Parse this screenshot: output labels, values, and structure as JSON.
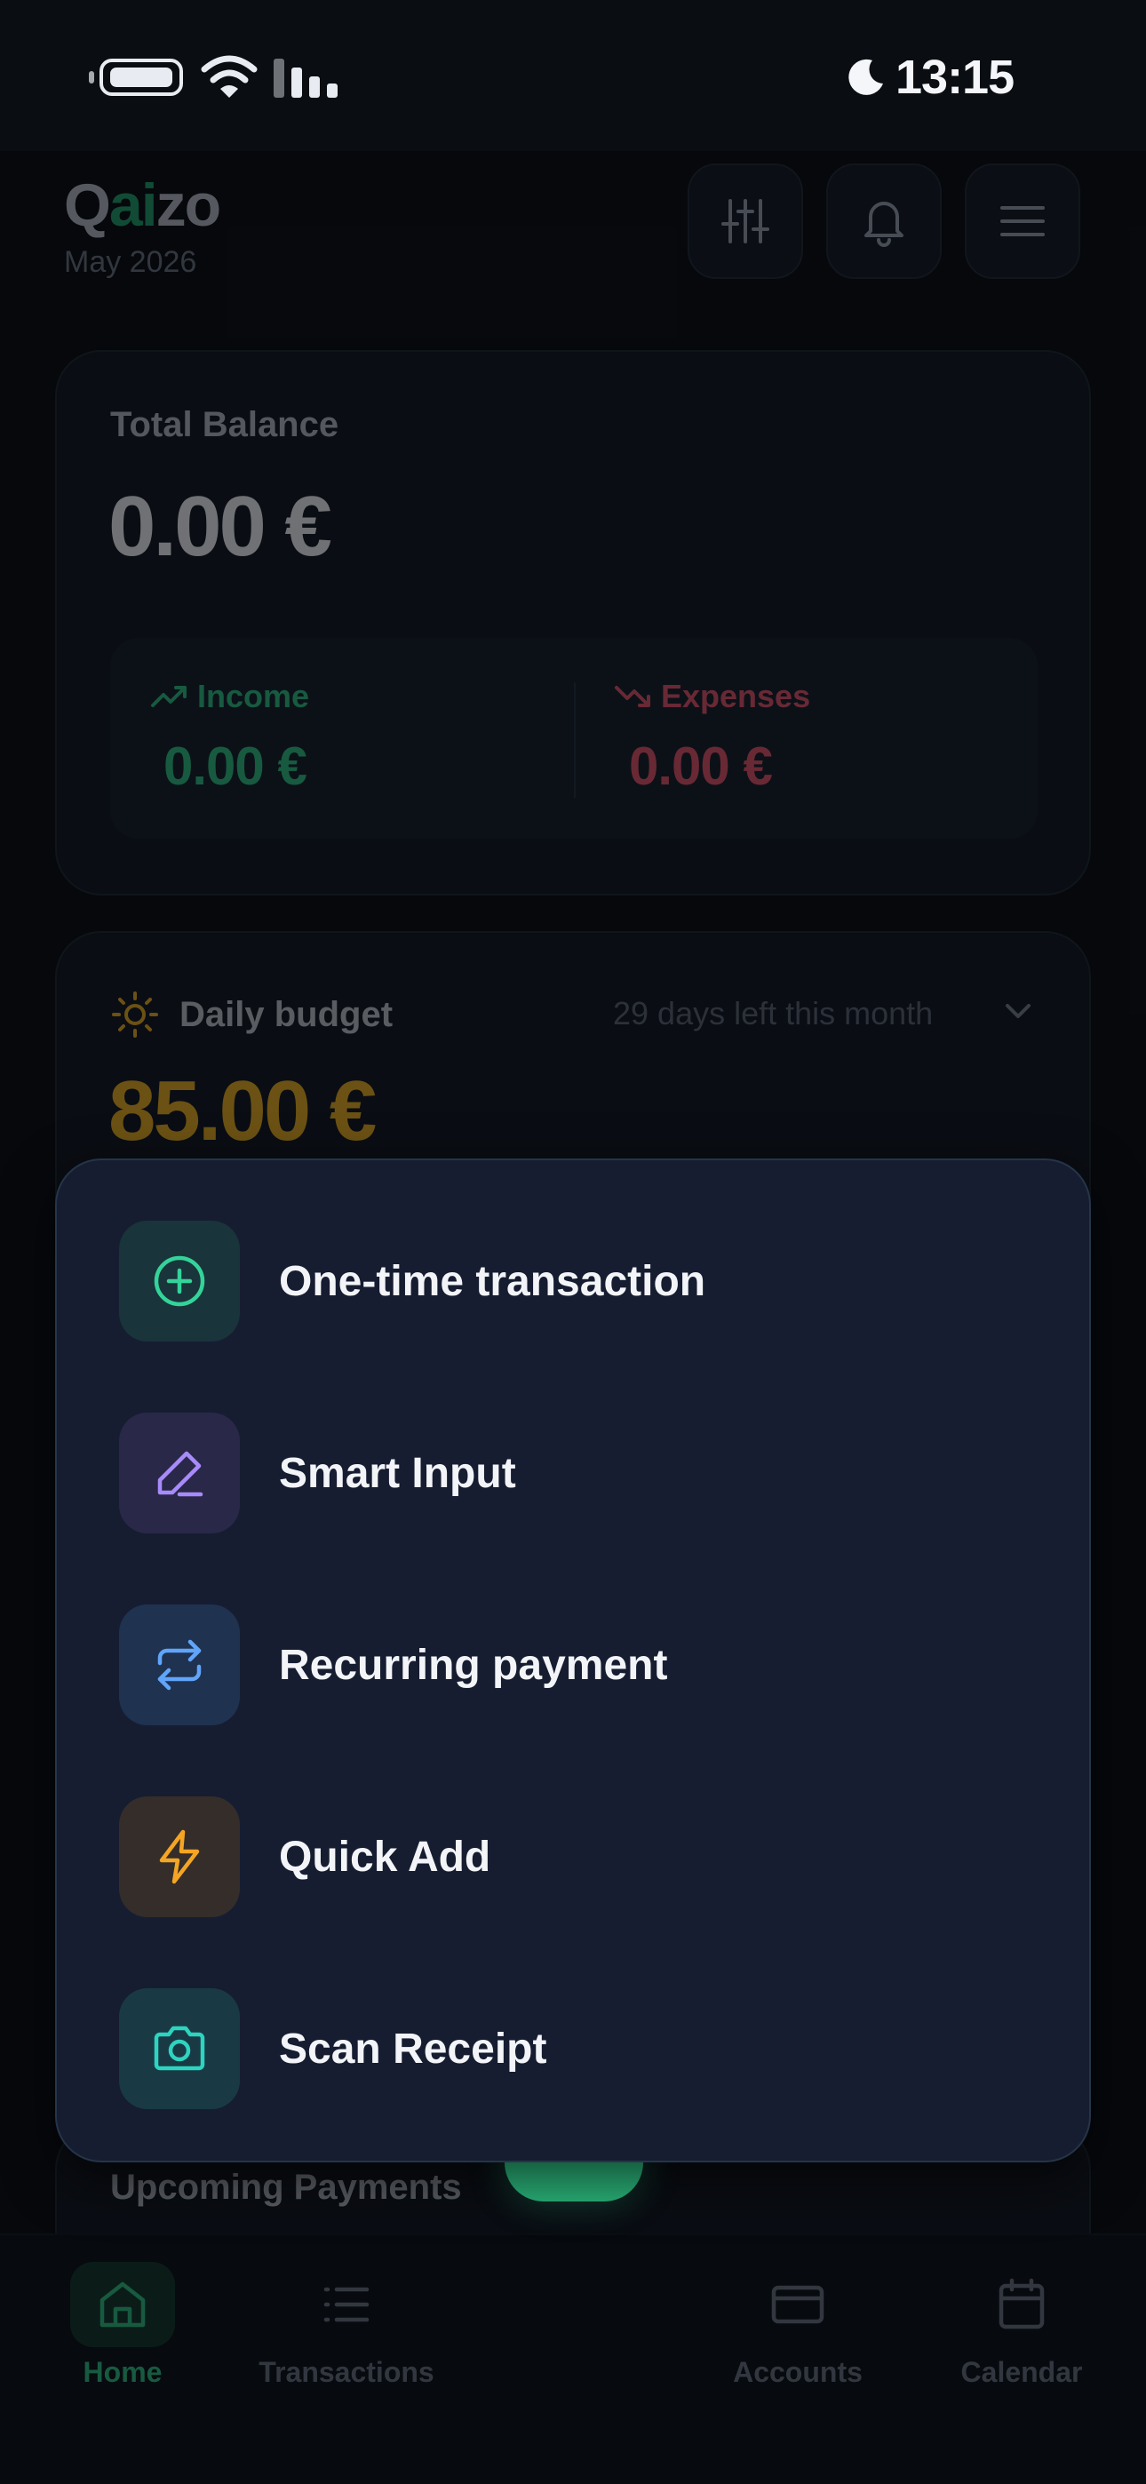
{
  "status_bar": {
    "time": "13:15"
  },
  "header": {
    "brand_prefix": "Q",
    "brand_accent": "ai",
    "brand_suffix": "zo",
    "month": "May 2026"
  },
  "balance": {
    "label": "Total Balance",
    "value": "0.00 €",
    "income_label": "Income",
    "income_value": "0.00 €",
    "expenses_label": "Expenses",
    "expenses_value": "0.00 €"
  },
  "budget": {
    "label": "Daily budget",
    "days_left": "29 days left this month",
    "value": "85.00 €"
  },
  "upcoming": {
    "title": "Upcoming Payments"
  },
  "sheet": {
    "items": [
      {
        "label": "One-time transaction",
        "icon": "plus-circle-icon"
      },
      {
        "label": "Smart Input",
        "icon": "pen-icon"
      },
      {
        "label": "Recurring payment",
        "icon": "repeat-icon"
      },
      {
        "label": "Quick Add",
        "icon": "lightning-icon"
      },
      {
        "label": "Scan Receipt",
        "icon": "camera-icon"
      }
    ]
  },
  "nav": {
    "home": "Home",
    "transactions": "Transactions",
    "accounts": "Accounts",
    "calendar": "Calendar"
  },
  "colors": {
    "accent_green": "#2bb57a",
    "income": "#2fc184",
    "expense": "#e2556a",
    "budget": "#e8ad1f",
    "sheet_bg": "#161d31"
  }
}
